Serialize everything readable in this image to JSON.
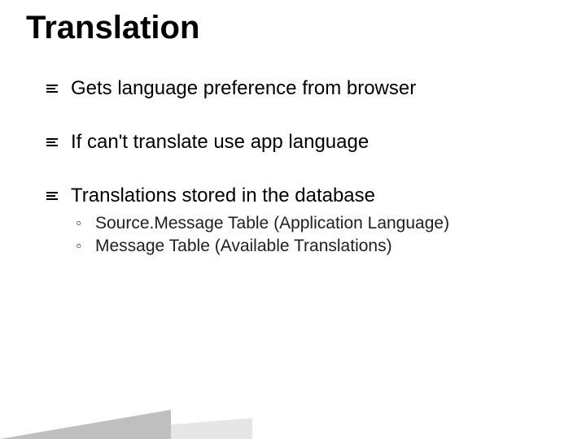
{
  "title": "Translation",
  "bullets": [
    {
      "text": "Gets language preference from browser",
      "sub": []
    },
    {
      "text": "If can't translate use app language",
      "sub": []
    },
    {
      "text": "Translations stored in the database",
      "sub": [
        "Source.Message Table (Application Language)",
        "Message Table (Available Translations)"
      ]
    }
  ]
}
